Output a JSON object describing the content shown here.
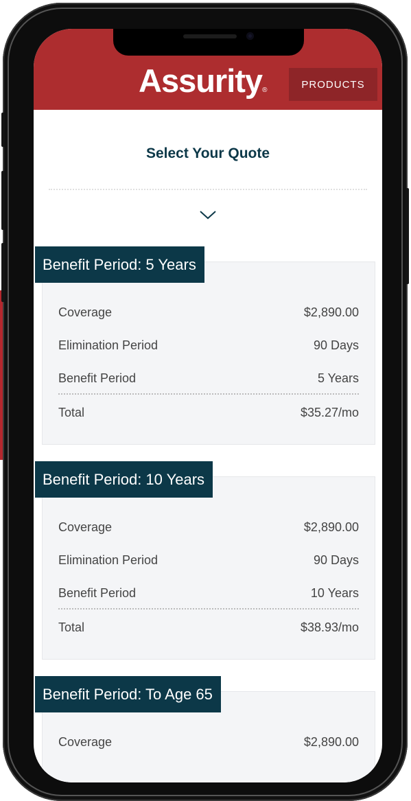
{
  "header": {
    "logo_text": "Assurity",
    "logo_mark": "®",
    "products_label": "PRODUCTS"
  },
  "page": {
    "title": "Select Your Quote"
  },
  "colors": {
    "brand_red": "#ad2d2f",
    "navy": "#0c3848",
    "card_bg": "#f4f5f7"
  },
  "quotes": [
    {
      "tag": "Benefit Period: 5 Years",
      "rows": [
        {
          "label": "Coverage",
          "value": "$2,890.00"
        },
        {
          "label": "Elimination Period",
          "value": "90 Days"
        },
        {
          "label": "Benefit Period",
          "value": "5 Years"
        }
      ],
      "total": {
        "label": "Total",
        "value": "$35.27/mo"
      }
    },
    {
      "tag": "Benefit Period: 10 Years",
      "rows": [
        {
          "label": "Coverage",
          "value": "$2,890.00"
        },
        {
          "label": "Elimination Period",
          "value": "90 Days"
        },
        {
          "label": "Benefit Period",
          "value": "10 Years"
        }
      ],
      "total": {
        "label": "Total",
        "value": "$38.93/mo"
      }
    },
    {
      "tag": "Benefit Period: To Age 65",
      "rows": [
        {
          "label": "Coverage",
          "value": "$2,890.00"
        }
      ]
    }
  ]
}
